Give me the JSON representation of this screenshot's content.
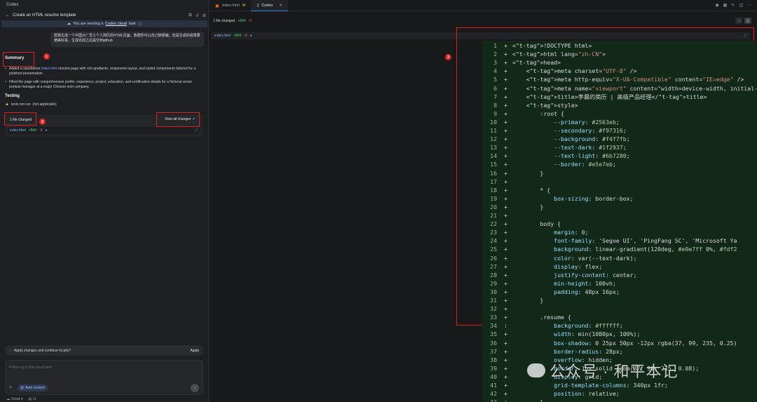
{
  "left": {
    "app_title": "Codex",
    "task_title": "Create an HTML resume template",
    "banner_prefix": "You are viewing a",
    "banner_link": "Codex cloud",
    "banner_suffix": "task",
    "user_message": "帮我生成一个中国大厂员工个人简历的HTML页面，数据你可以自己随便编，但是生成的结果要精美好看，生成完成之后提交到github",
    "summary_heading": "Summary",
    "summary_bullets": {
      "b1_pre": "Added a standalone",
      "b1_code": "index.html",
      "b1_post": "résumé page with rich gradients, responsive layout, and styled components tailored for a polished presentation.",
      "b2": "Filled the page with comprehensive profile, experience, project, education, and certification details for a fictional senior product manager at a major Chinese tech company."
    },
    "testing_heading": "Testing",
    "testing_item": "tests not run",
    "testing_note": "(not applicable)",
    "files_changed": "1 file changed",
    "view_all": "View all changes",
    "file": {
      "name": "index.html",
      "additions": "+554",
      "deletions": "-0"
    },
    "apply_prompt": "Apply changes and continue locally?",
    "apply_button": "Apply",
    "composer_placeholder": "Follow-up to this cloud task",
    "auto_context": "Auto context",
    "footer_env": "Cloud",
    "footer_count": "1x",
    "annotations": [
      "1",
      "2"
    ]
  },
  "right": {
    "tabs": [
      {
        "label": "index.html",
        "badge": "M"
      },
      {
        "label": "Codex"
      }
    ],
    "files_changed": "1 file changed",
    "additions": "+554",
    "deletions": "-0",
    "filebar": {
      "name": "index.html",
      "additions": "+554",
      "deletions": "-0"
    },
    "annotation": "3",
    "code_lines": [
      "<!DOCTYPE html>",
      "<html lang=\"zh-CN\">",
      "<head>",
      "    <meta charset=\"UTF-8\" />",
      "    <meta http-equiv=\"X-UA-Compatible\" content=\"IE=edge\" />",
      "    <meta name=\"viewport\" content=\"width=device-width, initial-sca",
      "    <title>李晨的简历 | 高级产品经理</title>",
      "    <style>",
      "        :root {",
      "            --primary: #2563eb;",
      "            --secondary: #f97316;",
      "            --background: #f4f7fb;",
      "            --text-dark: #1f2937;",
      "            --text-light: #6b7280;",
      "            --border: #e5e7eb;",
      "        }",
      "",
      "        * {",
      "            box-sizing: border-box;",
      "        }",
      "",
      "        body {",
      "            margin: 0;",
      "            font-family: 'Segoe UI', 'PingFang SC', 'Microsoft Ya",
      "            background: linear-gradient(120deg, #e0e7ff 0%, #fdf2",
      "            color: var(--text-dark);",
      "            display: flex;",
      "            justify-content: center;",
      "            min-height: 100vh;",
      "            padding: 48px 16px;",
      "        }",
      "",
      "        .resume {",
      "            background: #ffffff;",
      "            width: min(1080px, 100%);",
      "            box-shadow: 0 25px 50px -12px rgba(37, 99, 235, 0.25)",
      "            border-radius: 28px;",
      "            overflow: hidden;",
      "            border: 1px solid rgba(37, 99, 235, 0.08);",
      "            display: grid;",
      "            grid-template-columns: 340px 1fr;",
      "            position: relative;",
      "        }"
    ]
  },
  "watermark": "公众号 · 和平本记"
}
